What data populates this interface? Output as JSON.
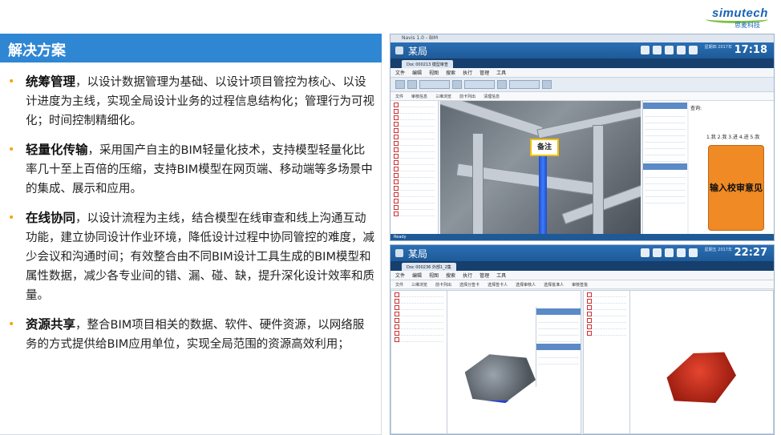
{
  "brand": {
    "logo_text": "simutech",
    "logo_sub": "思麦科技"
  },
  "section_title": "解决方案",
  "bullets": [
    {
      "title": "统筹管理",
      "text": "，以设计数据管理为基础、以设计项目管控为核心、以设计进度为主线，实现全局设计业务的过程信息结构化；管理行为可视化；时间控制精细化。"
    },
    {
      "title": "轻量化传输",
      "text": "，采用国产自主的BIM轻量化技术，支持模型轻量化比率几十至上百倍的压缩，支持BIM模型在网页端、移动端等多场景中的集成、展示和应用。"
    },
    {
      "title": "在线协同",
      "text": "，以设计流程为主线，结合模型在线审查和线上沟通互动功能，建立协同设计作业环境，降低设计过程中协同管控的难度，减少会议和沟通时间；有效整合由不同BIM设计工具生成的BIM模型和属性数据，减少各专业间的错、漏、碰、缺，提升深化设计效率和质量。"
    },
    {
      "title": "资源共享",
      "text": "，整合BIM项目相关的数据、软件、硬件资源，以网络服务的方式提供给BIM应用单位，实现全局范围的资源高效利用；"
    }
  ],
  "screenshot_top": {
    "window_title": "Navis 1.0 - BIM",
    "app_name": "某局",
    "time": "17:18",
    "date": "星期四 2017年",
    "doc_tab": "Doc 000213 模型审查",
    "menu": [
      "文件",
      "编辑",
      "视图",
      "搜索",
      "执行",
      "管理",
      "工具"
    ],
    "sub_tabs": [
      "文件",
      "审核信息",
      "三维浏览",
      "前卡列出",
      "清理信息"
    ],
    "note_label": "备注",
    "review_label": "查询:",
    "review_steps": "1.我 2.我 3.进 4.进 5.我",
    "review_button": "输入校审意见",
    "status": "Ready"
  },
  "screenshot_bottom": {
    "app_name": "某局",
    "time": "22:27",
    "date": "星期五 2017年",
    "doc_tab": "Doc 000236 外部1_2集",
    "menu": [
      "文件",
      "编辑",
      "视图",
      "搜索",
      "执行",
      "管理",
      "工具"
    ],
    "sub_tabs": [
      "文件",
      "三维浏览",
      "前卡列出",
      "选择分签卡",
      "选择签卡人",
      "选择审核人",
      "选择批准人",
      "审核签批"
    ]
  }
}
